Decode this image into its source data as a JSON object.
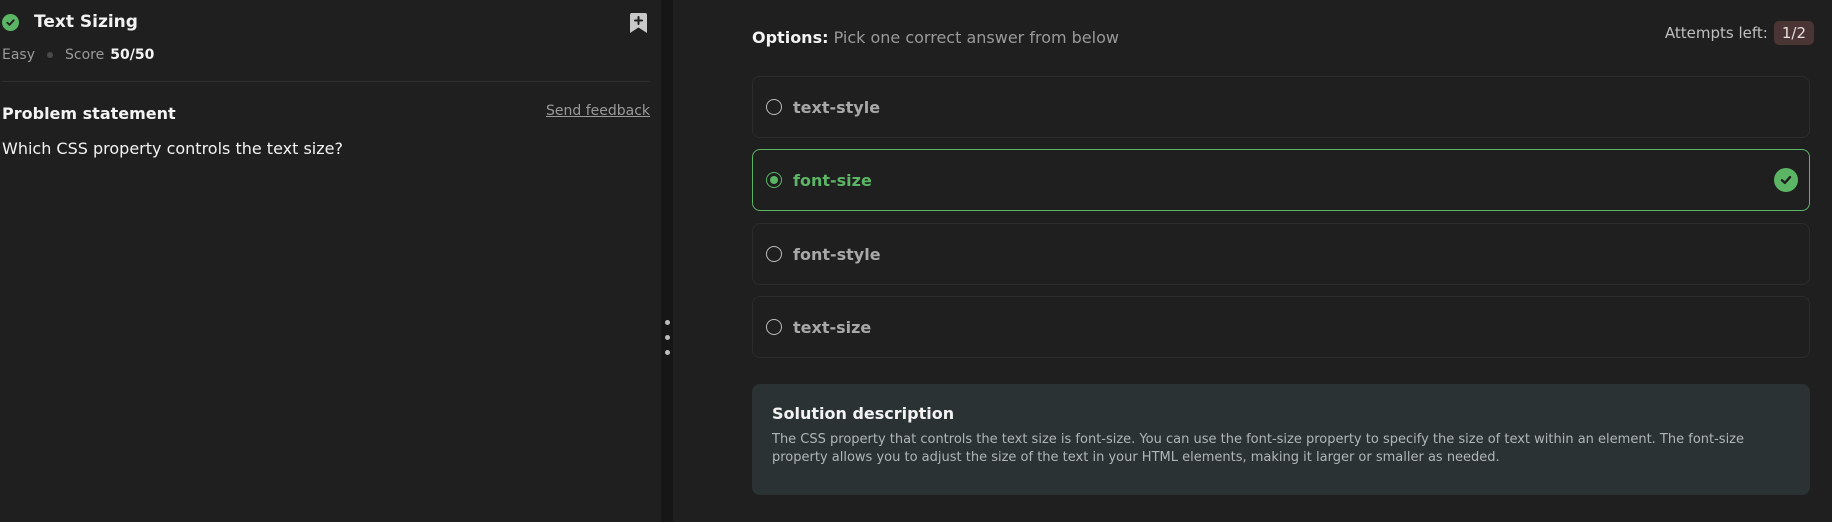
{
  "problem": {
    "title": "Text Sizing",
    "difficulty": "Easy",
    "score_label": "Score",
    "score_value": "50/50",
    "statement_heading": "Problem statement",
    "feedback_link": "Send feedback",
    "question": "Which CSS property controls the text size?"
  },
  "quiz": {
    "options_label": "Options:",
    "options_hint": "Pick one correct answer from below",
    "attempts_label": "Attempts left:",
    "attempts_value": "1/2",
    "options": [
      {
        "label": "text-style",
        "selected": false
      },
      {
        "label": "font-size",
        "selected": true,
        "correct": true
      },
      {
        "label": "font-style",
        "selected": false
      },
      {
        "label": "text-size",
        "selected": false
      }
    ]
  },
  "solution": {
    "heading": "Solution description",
    "body": "The CSS property that controls the text size is font-size. You can use the font-size property to specify the size of text within an element. The font-size property allows you to adjust the size of the text in your HTML elements, making it larger or smaller as needed."
  },
  "colors": {
    "background": "#1f1f1f",
    "accent_green": "#5bb565",
    "attempts_badge": "#4a3434",
    "solution_bg": "#2b3234"
  },
  "icons": {
    "solved": "check-circle-icon",
    "bookmark": "bookmark-plus-icon",
    "correct": "check-circle-icon",
    "resize_handle": "drag-handle-icon"
  }
}
